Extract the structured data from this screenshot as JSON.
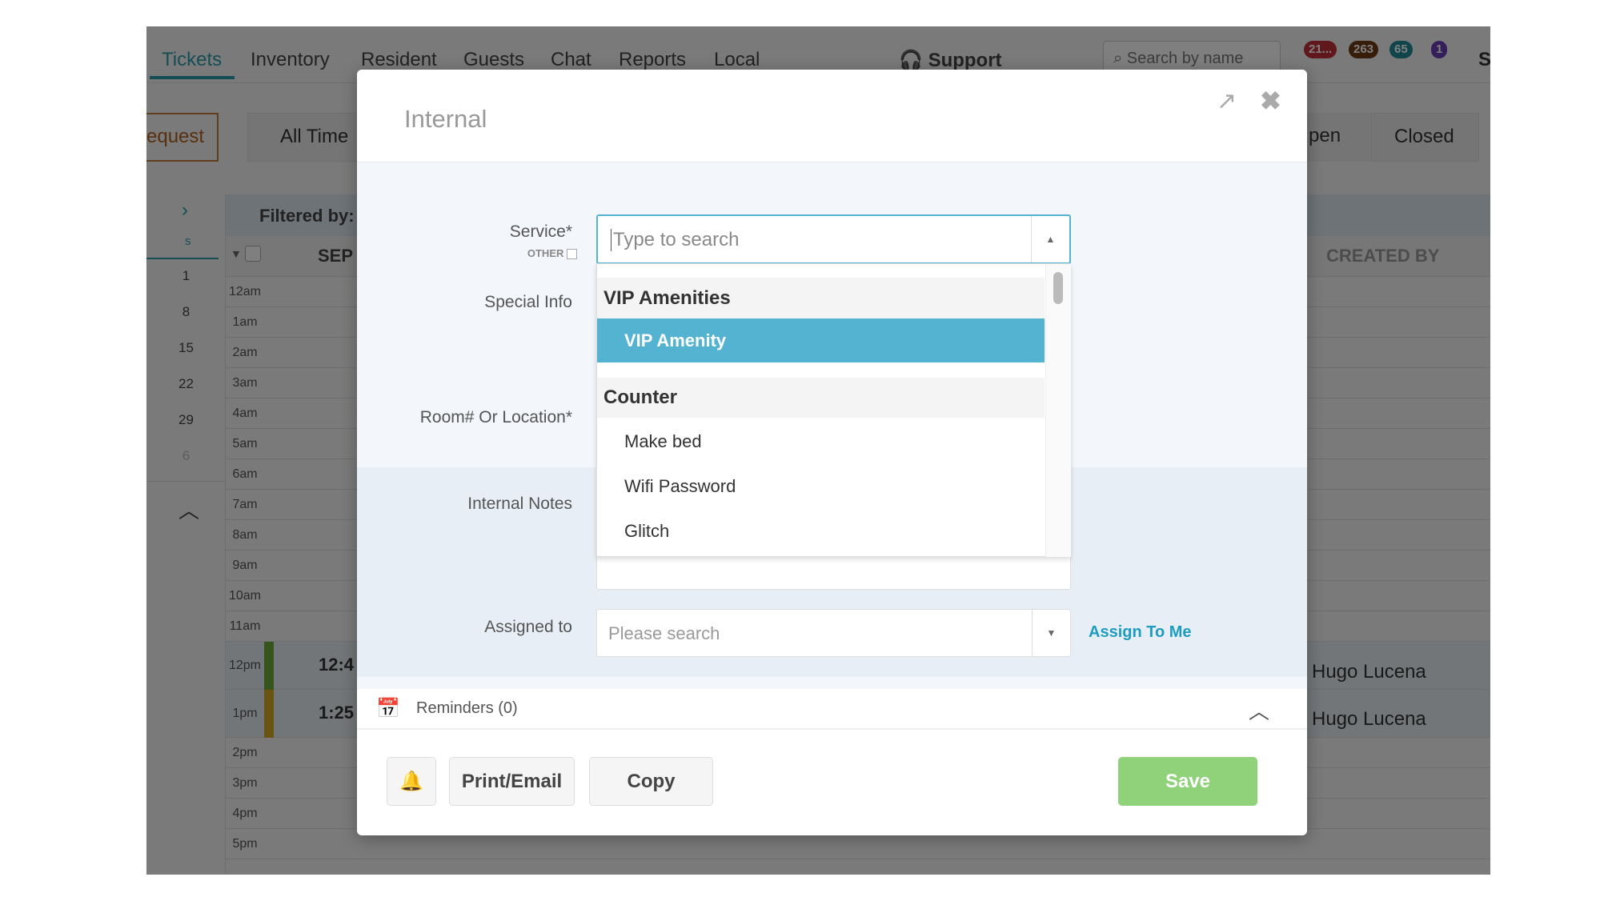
{
  "nav": {
    "tabs": [
      "Tickets",
      "Inventory",
      "Resident",
      "Guests",
      "Chat",
      "Reports",
      "Local"
    ],
    "support": "Support",
    "search_placeholder": "Search by name",
    "badges": [
      {
        "value": "21...",
        "color": "#c0303a"
      },
      {
        "value": "263",
        "color": "#6b3a12"
      },
      {
        "value": "65",
        "color": "#1e8a96"
      },
      {
        "value": "1",
        "color": "#6a3fb5"
      }
    ],
    "cut_label": "S"
  },
  "toolbar": {
    "request": "equest",
    "all_time": "All Time",
    "open": "pen",
    "closed": "Closed"
  },
  "filter": {
    "label": "Filtered by:"
  },
  "calendar": {
    "day_header": "s",
    "dates": [
      "1",
      "8",
      "15",
      "22",
      "29",
      "6"
    ]
  },
  "table": {
    "col_date": "SEP",
    "col_created_by": "CREATED BY",
    "hours": [
      "12am",
      "1am",
      "2am",
      "3am",
      "4am",
      "5am",
      "6am",
      "7am",
      "8am",
      "9am",
      "10am",
      "11am",
      "12pm",
      "1pm",
      "2pm",
      "3pm",
      "4pm",
      "5pm"
    ],
    "rows": [
      {
        "time": "12:4",
        "created_by": "Hugo Lucena",
        "color": "#6aaa3a"
      },
      {
        "time": "1:25",
        "created_by": "Hugo Lucena",
        "color": "#d4a928"
      }
    ]
  },
  "modal": {
    "title": "Internal",
    "labels": {
      "service": "Service*",
      "other": "OTHER",
      "special_info": "Special Info",
      "room": "Room# Or Location*",
      "notes": "Internal Notes",
      "assigned": "Assigned to"
    },
    "service_placeholder": "Type to search",
    "dropdown": {
      "groups": [
        {
          "label": "VIP Amenities",
          "options": [
            "VIP Amenity"
          ]
        },
        {
          "label": "Counter",
          "options": [
            "Make bed",
            "Wifi Password",
            "Glitch"
          ]
        }
      ],
      "selected": "VIP Amenity"
    },
    "assigned_placeholder": "Please search",
    "assign_to_me": "Assign To Me",
    "reminders": "Reminders (0)",
    "buttons": {
      "print": "Print/Email",
      "copy": "Copy",
      "save": "Save"
    },
    "accent": "#53b3d1",
    "save_color": "#8fd27a"
  }
}
